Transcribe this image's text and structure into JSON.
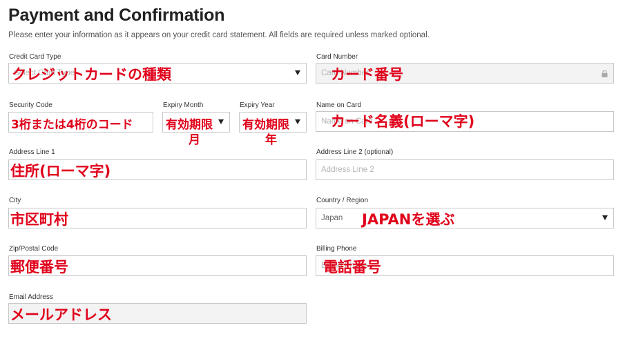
{
  "title": "Payment and Confirmation",
  "subtitle": "Please enter your information as it appears on your credit card statement. All fields are required unless marked optional.",
  "fields": {
    "card_type": {
      "label": "Credit Card Type",
      "placeholder": "Select Card Type",
      "annotation": "クレジットカードの種類"
    },
    "card_number": {
      "label": "Card Number",
      "placeholder": "Card Number",
      "annotation": "カード番号"
    },
    "security_code": {
      "label": "Security Code",
      "annotation": "3桁または4桁のコード"
    },
    "expiry_month": {
      "label": "Expiry Month",
      "annotation": "有効期限",
      "annotation2": "月"
    },
    "expiry_year": {
      "label": "Expiry Year",
      "annotation": "有効期限",
      "annotation2": "年"
    },
    "name_on_card": {
      "label": "Name on Card",
      "placeholder": "Name on Card",
      "annotation": "カード名義(ローマ字)"
    },
    "address1": {
      "label": "Address Line 1",
      "annotation": "住所(ローマ字)"
    },
    "address2": {
      "label": "Address Line 2 (optional)",
      "placeholder": "Address Line 2"
    },
    "city": {
      "label": "City",
      "annotation": "市区町村"
    },
    "country": {
      "label": "Country / Region",
      "value": "Japan",
      "annotation": "JAPANを選ぶ"
    },
    "zip": {
      "label": "Zip/Postal Code",
      "annotation": "郵便番号"
    },
    "phone": {
      "label": "Billing Phone",
      "placeholder": "Billing Phone",
      "annotation": "電話番号"
    },
    "email": {
      "label": "Email Address",
      "annotation": "メールアドレス"
    }
  },
  "colors": {
    "annotation": "#e0001a",
    "border": "#c8c8c8"
  }
}
